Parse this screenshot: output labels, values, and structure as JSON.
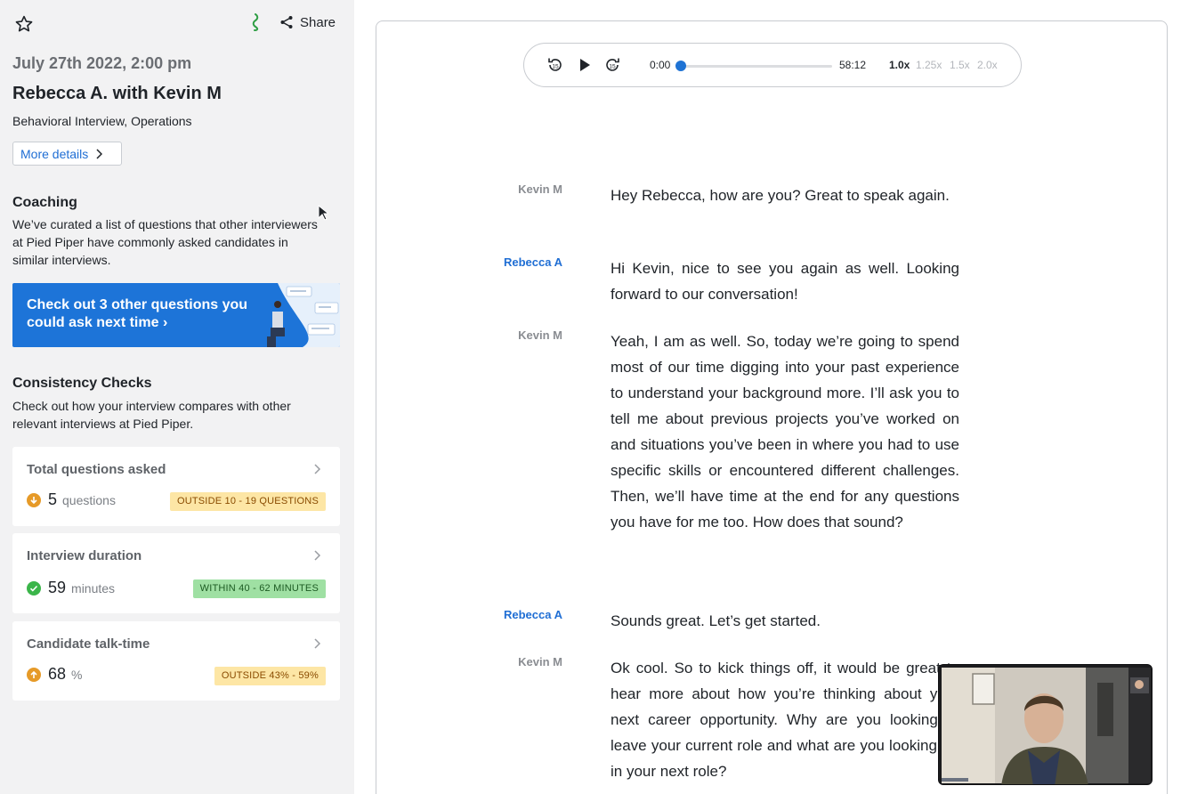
{
  "sidebar": {
    "star_icon": "star-icon",
    "brand_icon": "brand-icon",
    "share_label": "Share",
    "date": "July 27th 2022, 2:00 pm",
    "title": "Rebecca A. with Kevin M",
    "subtitle": "Behavioral Interview, Operations",
    "more_details": "More details",
    "coaching": {
      "heading": "Coaching",
      "text": "We’ve curated a list of questions that other interviewers at Pied Piper have commonly asked candidates in similar interviews.",
      "promo": "Check out 3 other questions you could ask next time ›"
    },
    "consistency": {
      "heading": "Consistency Checks",
      "text": "Check out how your interview compares with other relevant interviews at Pied Piper.",
      "cards": [
        {
          "title": "Total questions asked",
          "value": "5",
          "unit": "questions",
          "badge": "OUTSIDE 10 - 19 QUESTIONS",
          "status": "down"
        },
        {
          "title": "Interview duration",
          "value": "59",
          "unit": "minutes",
          "badge": "WITHIN 40 - 62 MINUTES",
          "status": "ok"
        },
        {
          "title": "Candidate talk-time",
          "value": "68",
          "unit": "%",
          "badge": "OUTSIDE 43% - 59%",
          "status": "up"
        }
      ]
    },
    "colors": {
      "accent": "#1d74d8",
      "warn": "#e69a28",
      "ok": "#3bb54a"
    }
  },
  "player": {
    "current_time": "0:00",
    "total_time": "58:12",
    "progress": 0.0,
    "speeds": [
      "1.0x",
      "1.25x",
      "1.5x",
      "2.0x"
    ],
    "active_speed": "1.0x"
  },
  "transcript": [
    {
      "speaker": "Kevin M",
      "text": "Hey Rebecca, how are you? Great to speak again."
    },
    {
      "speaker": "Rebecca A",
      "text": "Hi Kevin, nice to see you again as well. Looking forward to our conversation!"
    },
    {
      "speaker": "Kevin M",
      "text": "Yeah, I am as well. So, today we’re going to spend most of our time digging into your past experience to understand your background more. I’ll ask you to tell me about previous projects you’ve worked on and situations you’ve been in where you had to use specific skills or encountered different challenges. Then, we’ll have time at the end for any questions you have for me too. How does that sound?"
    },
    {
      "speaker": "Rebecca A",
      "text": "Sounds great. Let’s get started."
    },
    {
      "speaker": "Kevin M",
      "text": "Ok cool. So to kick things off, it would be great to hear more about how you’re thinking about your next career opportunity. Why are you looking to leave your current role and what are you looking for in your next role?"
    }
  ]
}
